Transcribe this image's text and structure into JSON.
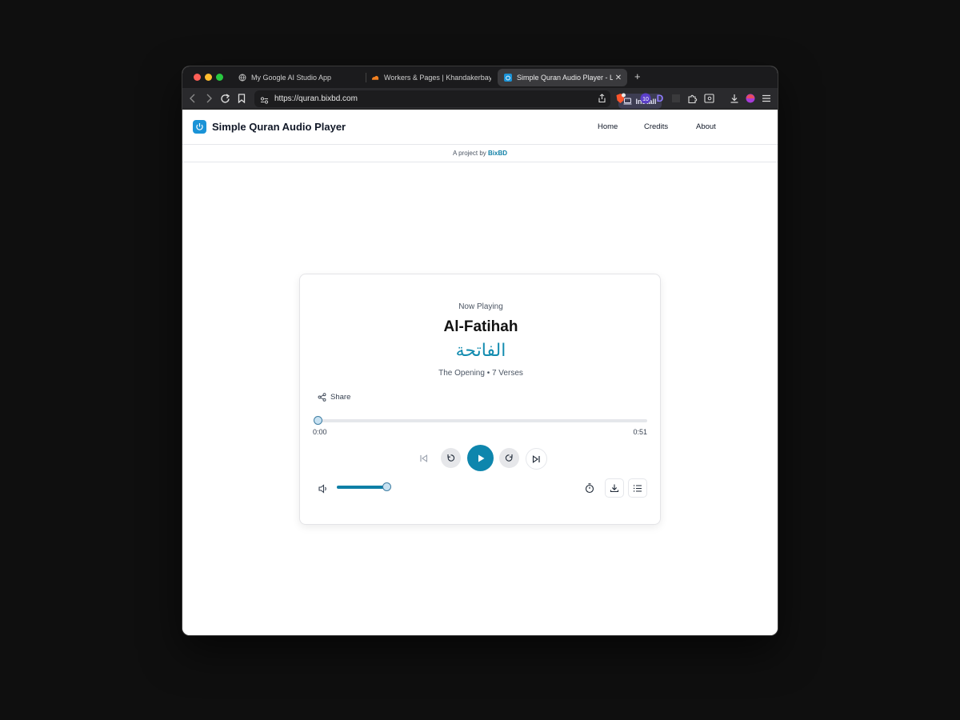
{
  "browser": {
    "tabs": [
      {
        "title": "My Google AI Studio App",
        "icon": "globe-icon"
      },
      {
        "title": "Workers & Pages | Khandakerbayazi",
        "icon": "cloudflare-icon"
      },
      {
        "title": "Simple Quran Audio Player - Li",
        "icon": "app-icon",
        "active": true
      }
    ],
    "url": "https://quran.bixbd.com",
    "install_label": "Install",
    "extension_badge": "10",
    "extension_letter": "D"
  },
  "site": {
    "title": "Simple Quran Audio Player",
    "nav": [
      "Home",
      "Credits",
      "About"
    ],
    "project_prefix": "A project by",
    "project_name": "BixBD"
  },
  "player": {
    "now_playing_label": "Now Playing",
    "surah_name": "Al-Fatihah",
    "surah_arabic": "الفاتحة",
    "surah_meta": "The Opening • 7 Verses",
    "share_label": "Share",
    "current_time": "0:00",
    "duration": "0:51",
    "progress_fraction": 0.0,
    "volume_fraction": 1.0,
    "accent_color": "#0e86ad"
  }
}
